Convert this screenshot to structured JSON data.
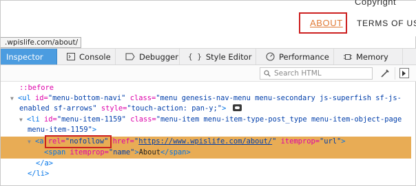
{
  "site": {
    "partial_top_text": "Copyright",
    "about_label": "ABOUT",
    "terms_label": "TERMS OF US",
    "url_tooltip": ".wpislife.com/about/"
  },
  "devtools": {
    "tabs": [
      {
        "label": "Inspector",
        "icon": "inspector-icon",
        "active": true
      },
      {
        "label": "Console",
        "icon": "console-icon"
      },
      {
        "label": "Debugger",
        "icon": "debugger-icon"
      },
      {
        "label": "Style Editor",
        "icon": "braces-icon"
      },
      {
        "label": "Performance",
        "icon": "performance-icon"
      },
      {
        "label": "Memory",
        "icon": "memory-icon"
      }
    ],
    "search_placeholder": "Search HTML"
  },
  "markup": {
    "l1": "::before",
    "l2_tag_open": "<ul",
    "l2_attr1": "id=",
    "l2_val1": "\"menu-bottom-navi\"",
    "l2_attr2": "class=",
    "l2_val2": "\"menu genesis-nav-menu menu-secondary js-superfish sf-js-",
    "l3_val2_cont": "enabled sf-arrows\"",
    "l3_attr3": "style=",
    "l3_val3": "\"touch-action: pan-y;\"",
    "l3_close": ">",
    "l4_tag_open": "<li",
    "l4_attr1": "id=",
    "l4_val1": "\"menu-item-1159\"",
    "l4_attr2": "class=",
    "l4_val2": "\"menu-item menu-item-type-post_type menu-item-object-page",
    "l5_val2_cont": "menu-item-1159\"",
    "l5_close": ">",
    "l6_tag_open": "<a",
    "l6_attr_rel": "rel=",
    "l6_val_rel": "\"nofollow\"",
    "l6_attr_href": "href=",
    "l6_quote_open": "\"",
    "l6_val_href": "https://www.wpislife.com/about/",
    "l6_quote_close": "\"",
    "l6_attr_itemprop": "itemprop=",
    "l6_val_itemprop": "\"url\"",
    "l6_close": ">",
    "l7_tag_open": "<span",
    "l7_attr": "itemprop=",
    "l7_val": "\"name\"",
    "l7_close": ">",
    "l7_text": "About",
    "l7_end": "</span>",
    "l8": "</a>",
    "l9": "</li>"
  },
  "colors": {
    "active_tab": "#4b9ce0",
    "selected_row": "#e8ac55",
    "highlight_box": "#cc1f1f",
    "link_orange": "#e07a36"
  }
}
